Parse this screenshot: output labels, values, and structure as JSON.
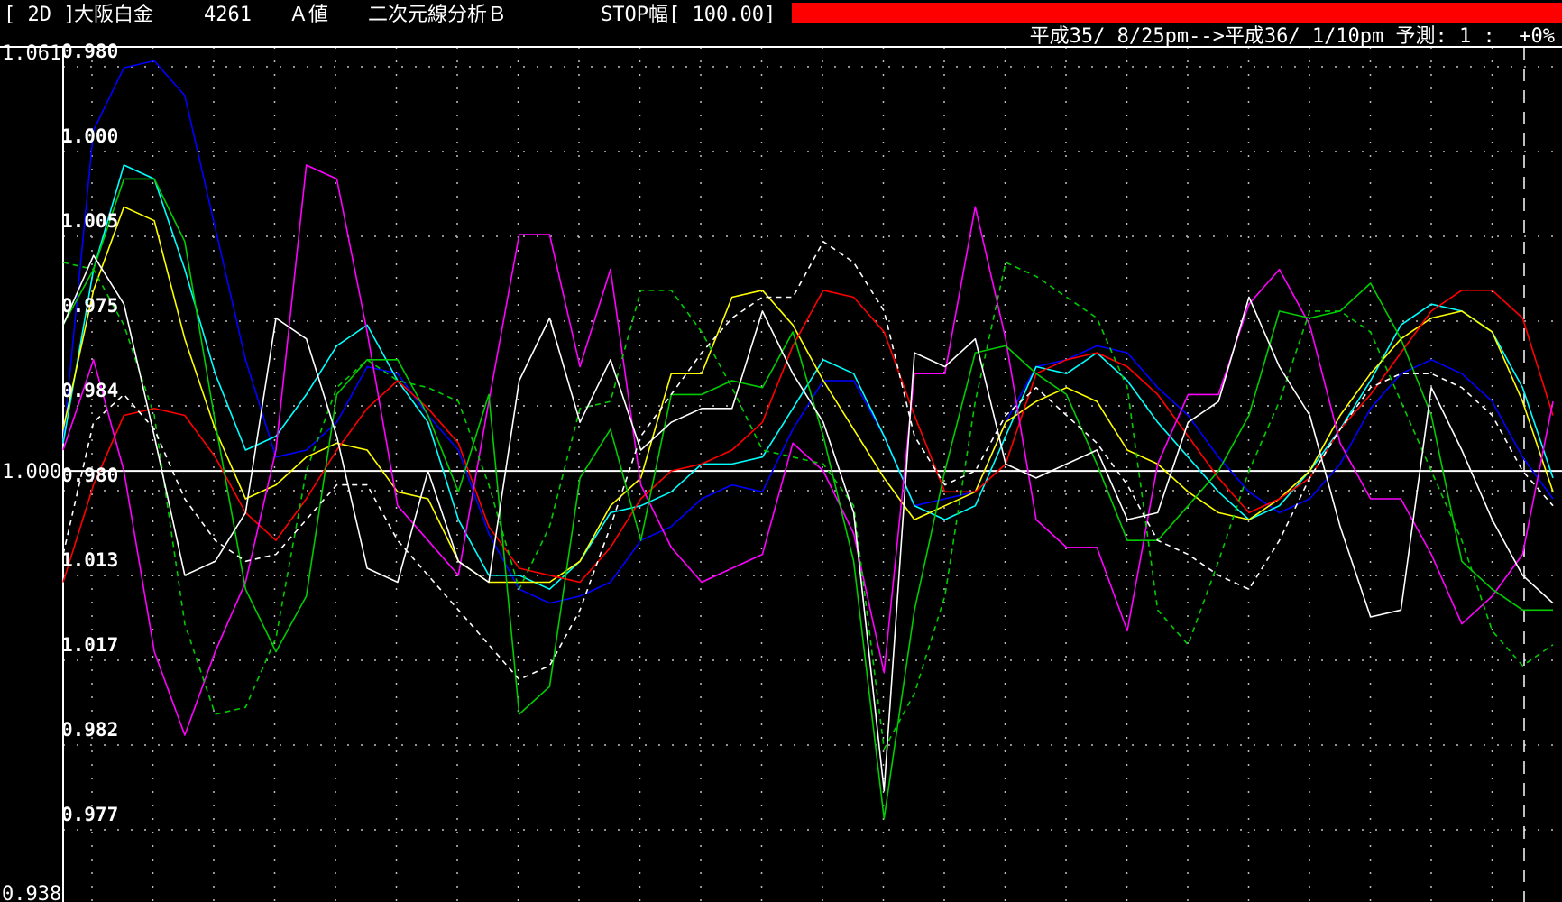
{
  "header": {
    "code_tag": "[ 2D ]",
    "name": "大阪白金",
    "number": "4261",
    "value_type": "Ａ値",
    "analysis": "二次元線分析Ｂ",
    "stop_width": "STOP幅[ 100.00]",
    "period": "平成35/ 8/25pm-->平成36/ 1/10pm",
    "forecast": "予測: 1 :  +0%"
  },
  "colors": {
    "background": "#000000",
    "stop_bar": "#ff0000",
    "grid": "#bfbfbf"
  },
  "chart_data": {
    "type": "line",
    "left_scale": [
      "1.061",
      "1.000",
      "0.938"
    ],
    "y_ticks": [
      "0.980",
      "1.000",
      "1.005",
      "0.975",
      "0.984",
      "0.980",
      "1.013",
      "1.017",
      "0.982",
      "0.977"
    ],
    "ylim": [
      0.938,
      1.061
    ],
    "baseline": 1.0,
    "x_count": 50,
    "grid": true,
    "series": [
      {
        "color": "#0000ff",
        "dashed": false,
        "values": [
          1.004,
          1.049,
          1.058,
          1.059,
          1.054,
          1.035,
          1.016,
          1.002,
          1.003,
          1.007,
          1.015,
          1.014,
          1.008,
          1.003,
          0.991,
          0.983,
          0.981,
          0.982,
          0.984,
          0.99,
          0.992,
          0.996,
          0.998,
          0.997,
          1.006,
          1.013,
          1.013,
          1.005,
          0.995,
          0.996,
          0.997,
          1.007,
          1.015,
          1.016,
          1.018,
          1.017,
          1.012,
          1.008,
          1.002,
          0.997,
          0.994,
          0.996,
          1.001,
          1.009,
          1.014,
          1.016,
          1.014,
          1.01,
          1.002,
          0.996
        ]
      },
      {
        "color": "#00ffff",
        "dashed": false,
        "values": [
          1.004,
          1.029,
          1.044,
          1.042,
          1.029,
          1.014,
          1.003,
          1.005,
          1.011,
          1.018,
          1.021,
          1.013,
          1.007,
          0.993,
          0.985,
          0.985,
          0.983,
          0.987,
          0.994,
          0.995,
          0.997,
          1.001,
          1.001,
          1.002,
          1.009,
          1.016,
          1.014,
          1.005,
          0.995,
          0.993,
          0.995,
          1.005,
          1.015,
          1.014,
          1.017,
          1.013,
          1.007,
          1.002,
          0.997,
          0.993,
          0.995,
          1.0,
          1.006,
          1.013,
          1.021,
          1.024,
          1.023,
          1.02,
          1.012,
          0.999
        ]
      },
      {
        "color": "#ffff00",
        "dashed": false,
        "values": [
          1.006,
          1.026,
          1.038,
          1.036,
          1.019,
          1.006,
          0.996,
          0.998,
          1.002,
          1.004,
          1.003,
          0.997,
          0.996,
          0.987,
          0.984,
          0.984,
          0.984,
          0.987,
          0.995,
          0.999,
          1.014,
          1.014,
          1.025,
          1.026,
          1.021,
          1.013,
          1.006,
          0.999,
          0.993,
          0.995,
          0.997,
          1.007,
          1.01,
          1.012,
          1.01,
          1.003,
          1.001,
          0.997,
          0.994,
          0.993,
          0.996,
          1.0,
          1.008,
          1.014,
          1.019,
          1.022,
          1.023,
          1.02,
          1.01,
          0.997
        ]
      },
      {
        "color": "#ff0000",
        "dashed": false,
        "values": [
          0.984,
          0.998,
          1.008,
          1.009,
          1.008,
          1.002,
          0.994,
          0.99,
          0.996,
          1.003,
          1.009,
          1.013,
          1.009,
          1.004,
          0.992,
          0.986,
          0.985,
          0.984,
          0.989,
          0.996,
          1.0,
          1.001,
          1.003,
          1.007,
          1.018,
          1.026,
          1.025,
          1.02,
          1.008,
          0.997,
          0.997,
          1.001,
          1.014,
          1.016,
          1.017,
          1.015,
          1.011,
          1.005,
          0.999,
          0.994,
          0.996,
          0.999,
          1.006,
          1.011,
          1.017,
          1.023,
          1.026,
          1.026,
          1.022,
          1.008
        ]
      },
      {
        "color": "#ff00ff",
        "dashed": false,
        "values": [
          1.003,
          1.016,
          1.0,
          0.974,
          0.962,
          0.974,
          0.984,
          1.003,
          1.044,
          1.042,
          1.02,
          0.995,
          0.99,
          0.985,
          1.01,
          1.034,
          1.034,
          1.015,
          1.029,
          0.998,
          0.989,
          0.984,
          0.986,
          0.988,
          1.004,
          1.0,
          0.991,
          0.971,
          1.014,
          1.014,
          1.038,
          1.019,
          0.993,
          0.989,
          0.989,
          0.977,
          1.001,
          1.011,
          1.011,
          1.024,
          1.029,
          1.021,
          1.004,
          0.996,
          0.996,
          0.988,
          0.978,
          0.982,
          0.988,
          1.01
        ]
      },
      {
        "color": "#00cc00",
        "dashed": false,
        "values": [
          1.021,
          1.029,
          1.042,
          1.042,
          1.033,
          1.007,
          0.983,
          0.974,
          0.982,
          1.011,
          1.016,
          1.016,
          1.008,
          0.997,
          1.011,
          0.965,
          0.969,
          0.999,
          1.006,
          0.99,
          1.011,
          1.011,
          1.013,
          1.012,
          1.02,
          1.005,
          0.987,
          0.95,
          0.98,
          1.0,
          1.017,
          1.018,
          1.014,
          1.011,
          1.001,
          0.99,
          0.99,
          0.995,
          1.0,
          1.008,
          1.023,
          1.022,
          1.023,
          1.027,
          1.019,
          1.008,
          0.987,
          0.983,
          0.98,
          0.98
        ]
      },
      {
        "color": "#00cc00",
        "dashed": true,
        "values": [
          1.03,
          1.029,
          1.021,
          1.008,
          0.978,
          0.965,
          0.966,
          0.976,
          1.0,
          1.012,
          1.016,
          1.013,
          1.012,
          1.01,
          0.998,
          0.983,
          0.992,
          1.009,
          1.01,
          1.026,
          1.026,
          1.02,
          1.012,
          1.003,
          1.002,
          1.001,
          0.995,
          0.96,
          0.968,
          0.982,
          1.01,
          1.03,
          1.028,
          1.025,
          1.022,
          1.012,
          0.98,
          0.975,
          0.987,
          1.0,
          1.01,
          1.023,
          1.023,
          1.02,
          1.01,
          1.0,
          0.99,
          0.977,
          0.972,
          0.975
        ]
      },
      {
        "color": "#ffffff",
        "dashed": false,
        "values": [
          1.021,
          1.031,
          1.024,
          1.005,
          0.985,
          0.987,
          0.994,
          1.022,
          1.019,
          1.005,
          0.986,
          0.984,
          1.0,
          0.987,
          0.984,
          1.013,
          1.022,
          1.007,
          1.016,
          1.003,
          1.007,
          1.009,
          1.009,
          1.023,
          1.014,
          1.007,
          0.994,
          0.954,
          1.017,
          1.015,
          1.019,
          1.001,
          0.999,
          1.001,
          1.003,
          0.993,
          0.994,
          1.007,
          1.01,
          1.025,
          1.015,
          1.008,
          0.992,
          0.979,
          0.98,
          1.012,
          1.003,
          0.993,
          0.985,
          0.981
        ]
      },
      {
        "color": "#ffffff",
        "dashed": true,
        "values": [
          0.988,
          1.007,
          1.011,
          1.006,
          0.996,
          0.99,
          0.987,
          0.988,
          0.993,
          0.998,
          0.998,
          0.99,
          0.985,
          0.98,
          0.975,
          0.97,
          0.972,
          0.98,
          0.992,
          1.005,
          1.011,
          1.017,
          1.022,
          1.025,
          1.025,
          1.033,
          1.03,
          1.023,
          1.005,
          0.998,
          1.0,
          1.008,
          1.012,
          1.008,
          1.004,
          0.998,
          0.99,
          0.988,
          0.985,
          0.983,
          0.99,
          0.999,
          1.006,
          1.012,
          1.014,
          1.014,
          1.012,
          1.008,
          1.0,
          0.995
        ]
      }
    ]
  }
}
